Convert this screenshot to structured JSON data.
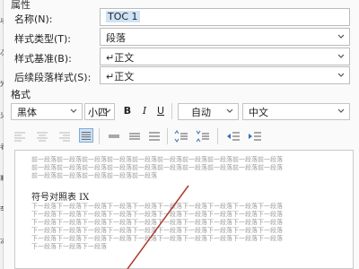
{
  "background": {
    "side_chars": [
      "项",
      "次",
      "外",
      "见",
      "表",
      "籍",
      "举",
      "流"
    ]
  },
  "properties": {
    "group_title": "属性",
    "name_label": "名称(N):",
    "name_value": "TOC 1",
    "style_type_label": "样式类型(T):",
    "style_type_value": "段落",
    "based_on_label": "样式基准(B):",
    "based_on_value": "↵正文",
    "next_style_label": "后续段落样式(S):",
    "next_style_value": "↵正文"
  },
  "format": {
    "title": "格式",
    "font": "黑体",
    "size": "小四",
    "bold": "B",
    "italic": "I",
    "underline": "U",
    "color": "自动",
    "language": "中文"
  },
  "preview": {
    "before_lines": [
      "前一段落前一段落前一段落前一段落前一段落前一段落前一段落前一段落前一段落前一段落",
      "前一段落前一段落前一段落前一段落前一段落前一段落前一段落前一段落前一段落前一段落",
      "前一段落前一段落前一段落前一段落前一段落"
    ],
    "sample_text": "符号对照表 IX",
    "after_lines": [
      "下一段落下一段落下一段落下一段落下一段落下一段落下一段落下一段落下一段落下一段落",
      "下一段落下一段落下一段落下一段落下一段落下一段落下一段落下一段落下一段落下一段落",
      "下一段落下一段落下一段落下一段落下一段落下一段落下一段落下一段落下一段落下一段落",
      "下一段落下一段落下一段落下一段落下一段落下一段落下一段落下一段落下一段落下一段落",
      "下一段落下一段落下一段落下一段落下一段落下一段落下一段落下一段落下一段落下一段落",
      "下一段落下一段落下一段落"
    ]
  },
  "colors": {
    "selection": "#cfe3f7",
    "annotation_line": "#b03a2e"
  }
}
